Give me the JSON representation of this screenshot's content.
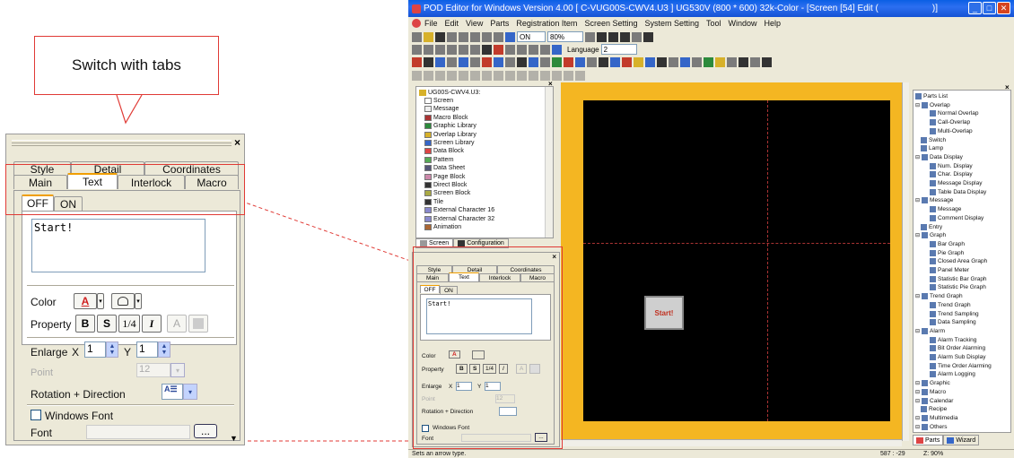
{
  "callout": {
    "text": "Switch with tabs"
  },
  "zoom_panel": {
    "close": "×",
    "tabs_top": [
      "Style",
      "Detail",
      "Coordinates"
    ],
    "tabs_bottom": [
      "Main",
      "Text",
      "Interlock",
      "Macro"
    ],
    "active_tab": "Text",
    "state_tabs": [
      "OFF",
      "ON"
    ],
    "text_value": "Start!",
    "color_label": "Color",
    "color_button": "A",
    "property_label": "Property",
    "prop_bold": "B",
    "prop_shadow": "S",
    "prop_quarter": "1/4",
    "prop_italic": "I",
    "prop_a": "A",
    "enlarge_label": "Enlarge",
    "x_label": "X",
    "x_value": "1",
    "y_label": "Y",
    "y_value": "1",
    "point_label": "Point",
    "point_value": "12",
    "rotation_label": "Rotation + Direction",
    "windows_font_label": "Windows Font",
    "font_label": "Font",
    "font_browse": "..."
  },
  "window": {
    "title": "POD Editor for Windows Version 4.00 [ C-VUG00S-CWV4.U3 ] UG530V (800 * 600) 32k-Color - [Screen [54] Edit (",
    "title_tail": ")]",
    "menu": [
      "File",
      "Edit",
      "View",
      "Parts",
      "Registration Item",
      "Screen Setting",
      "System Setting",
      "Tool",
      "Window",
      "Help"
    ],
    "toolbar": {
      "on_value": "ON",
      "zoom_value": "80%",
      "language_label": "Language",
      "language_value": "2"
    },
    "tree": {
      "root": "UG00S-CWV4.U3:",
      "items": [
        "Screen",
        "Message",
        "Macro Block",
        "Graphic Library",
        "Overlap Library",
        "Screen Library",
        "Data Block",
        "Pattern",
        "Data Sheet",
        "Page Block",
        "Direct Block",
        "Screen Block",
        "Tile",
        "External Character 16",
        "External Character 32",
        "Animation"
      ],
      "tabs": [
        "Screen",
        "Configuration"
      ]
    },
    "canvas_button": "Start!",
    "parts": {
      "items": [
        {
          "label": "Parts List",
          "level": 0
        },
        {
          "label": "Overlap",
          "level": 0
        },
        {
          "label": "Normal Overlap",
          "level": 2
        },
        {
          "label": "Call-Overlap",
          "level": 2
        },
        {
          "label": "Multi-Overlap",
          "level": 2
        },
        {
          "label": "Switch",
          "level": 1
        },
        {
          "label": "Lamp",
          "level": 1
        },
        {
          "label": "Data Display",
          "level": 0
        },
        {
          "label": "Num. Display",
          "level": 2
        },
        {
          "label": "Char. Display",
          "level": 2
        },
        {
          "label": "Message Display",
          "level": 2
        },
        {
          "label": "Table Data Display",
          "level": 2
        },
        {
          "label": "Message",
          "level": 0
        },
        {
          "label": "Message",
          "level": 2
        },
        {
          "label": "Comment Display",
          "level": 2
        },
        {
          "label": "Entry",
          "level": 1
        },
        {
          "label": "Graph",
          "level": 0
        },
        {
          "label": "Bar Graph",
          "level": 2
        },
        {
          "label": "Pie Graph",
          "level": 2
        },
        {
          "label": "Closed Area Graph",
          "level": 2
        },
        {
          "label": "Panel Meter",
          "level": 2
        },
        {
          "label": "Statistic Bar Graph",
          "level": 2
        },
        {
          "label": "Statistic Pie Graph",
          "level": 2
        },
        {
          "label": "Trend Graph",
          "level": 0
        },
        {
          "label": "Trend Graph",
          "level": 2
        },
        {
          "label": "Trend Sampling",
          "level": 2
        },
        {
          "label": "Data Sampling",
          "level": 2
        },
        {
          "label": "Alarm",
          "level": 0
        },
        {
          "label": "Alarm Tracking",
          "level": 2
        },
        {
          "label": "Bit Order Alarming",
          "level": 2
        },
        {
          "label": "Alarm Sub Display",
          "level": 2
        },
        {
          "label": "Time Order Alarming",
          "level": 2
        },
        {
          "label": "Alarm Logging",
          "level": 2
        },
        {
          "label": "Graphic",
          "level": 0
        },
        {
          "label": "Macro",
          "level": 0
        },
        {
          "label": "Calendar",
          "level": 0
        },
        {
          "label": "Recipe",
          "level": 1
        },
        {
          "label": "Multimedia",
          "level": 0
        },
        {
          "label": "Others",
          "level": 0
        }
      ],
      "tabs": [
        "Parts",
        "Wizard"
      ]
    },
    "status": {
      "message": "Sets an arrow type.",
      "coords": "587 : -29",
      "zoom": "Z: 90%"
    }
  }
}
